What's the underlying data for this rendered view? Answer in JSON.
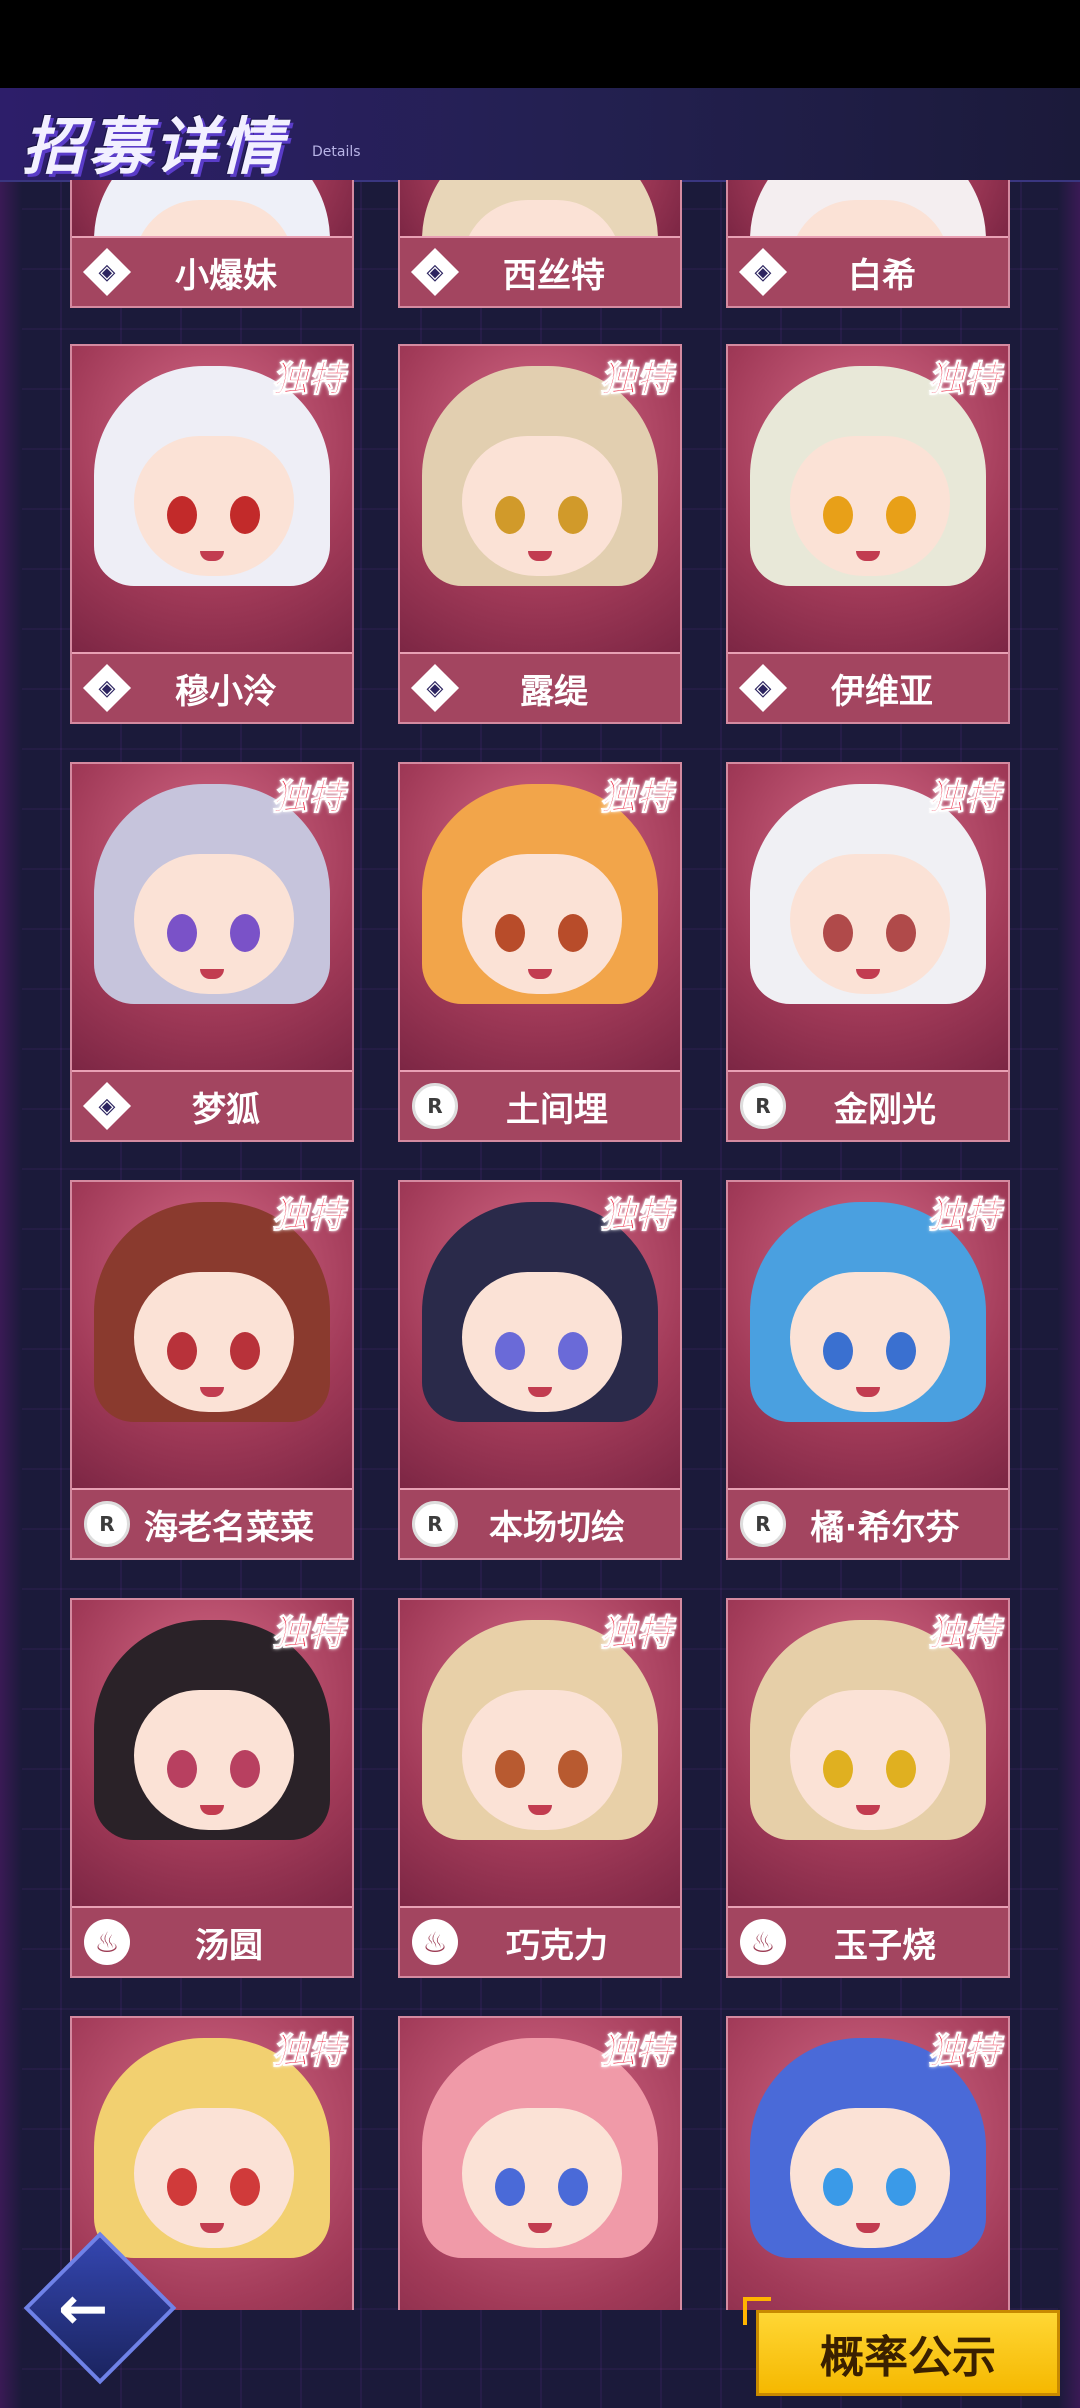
{
  "header": {
    "title": "招募详情",
    "subtitle": "Details"
  },
  "cards": [
    {
      "name": "小爆妹",
      "icon": "diamond",
      "badge": ""
    },
    {
      "name": "西丝特",
      "icon": "diamond",
      "badge": ""
    },
    {
      "name": "白希",
      "icon": "diamond",
      "badge": ""
    },
    {
      "name": "穆小泠",
      "icon": "diamond",
      "badge": "独特"
    },
    {
      "name": "露缇",
      "icon": "diamond",
      "badge": "独特"
    },
    {
      "name": "伊维亚",
      "icon": "diamond",
      "badge": "独特"
    },
    {
      "name": "梦狐",
      "icon": "diamond",
      "badge": "独特"
    },
    {
      "name": "土间埋",
      "icon": "bear",
      "badge": "独特"
    },
    {
      "name": "金刚光",
      "icon": "bear",
      "badge": "独特"
    },
    {
      "name": "海老名菜菜",
      "icon": "bear",
      "badge": "独特"
    },
    {
      "name": "本场切绘",
      "icon": "bear",
      "badge": "独特"
    },
    {
      "name": "橘·希尔芬",
      "icon": "bear",
      "badge": "独特"
    },
    {
      "name": "汤圆",
      "icon": "flame",
      "badge": "独特"
    },
    {
      "name": "巧克力",
      "icon": "flame",
      "badge": "独特"
    },
    {
      "name": "玉子烧",
      "icon": "flame",
      "badge": "独特"
    },
    {
      "name": "",
      "icon": "",
      "badge": "独特"
    },
    {
      "name": "",
      "icon": "",
      "badge": "独特"
    },
    {
      "name": "",
      "icon": "",
      "badge": "独特"
    }
  ],
  "footer": {
    "probability_button": "概率公示",
    "back_icon": "back-arrow-icon"
  }
}
